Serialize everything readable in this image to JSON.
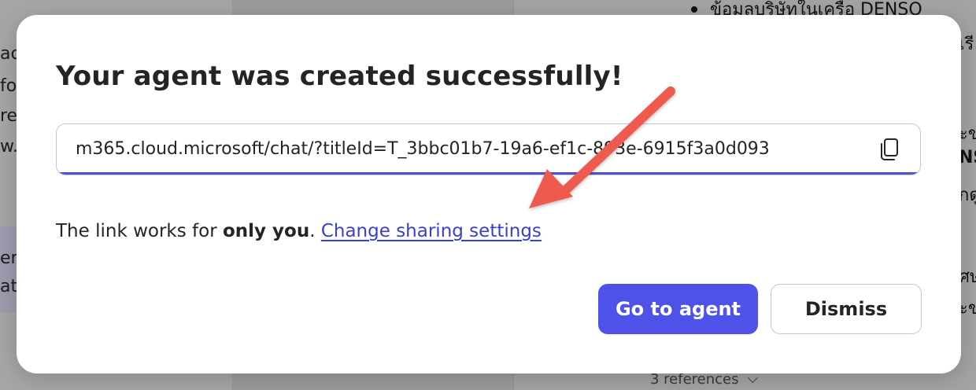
{
  "background": {
    "left_fragments": [
      "ac",
      "fo",
      "re",
      "w.",
      "en",
      "at,"
    ],
    "right_fragments": [
      "ข้อมูลบริษัทในเครือ DENSO",
      "เรี",
      "ะข",
      "NS",
      "กดู",
      "ศษ",
      "ะข"
    ],
    "references_label": "3 references"
  },
  "dialog": {
    "title": "Your agent was created successfully!",
    "link_value": "m365.cloud.microsoft/chat/?titleId=T_3bbc01b7-19a6-ef1c-893e-6915f3a0d093",
    "copy_icon": "copy-icon",
    "share_prefix": "The link works for ",
    "share_emphasis": "only you",
    "share_suffix": ". ",
    "share_link_label": "Change sharing settings",
    "primary_button": "Go to agent",
    "secondary_button": "Dismiss"
  },
  "colors": {
    "accent": "#4f52e8",
    "link": "#3b3fd0",
    "annotation_arrow": "#ef5a4f"
  }
}
